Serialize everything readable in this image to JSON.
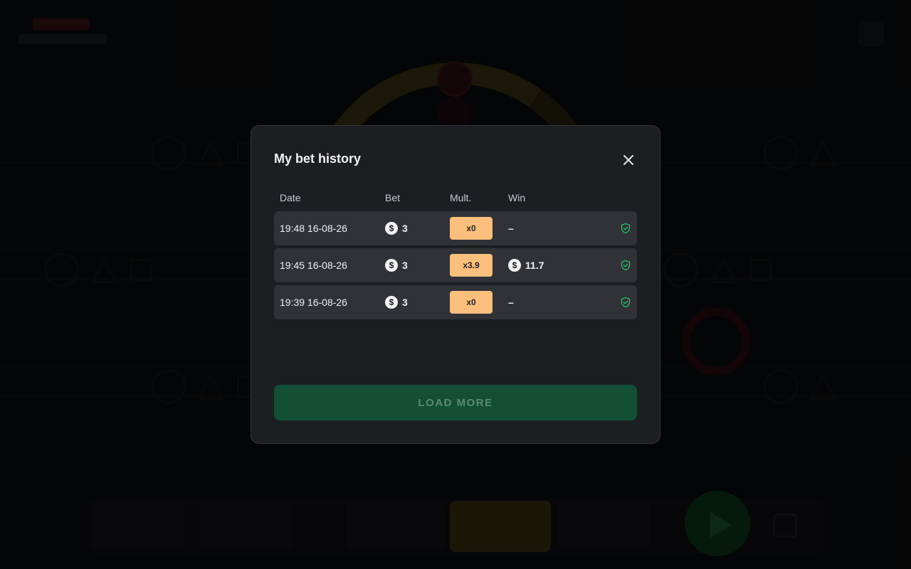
{
  "modal": {
    "title": "My bet history",
    "columns": {
      "date": "Date",
      "bet": "Bet",
      "mult": "Mult.",
      "win": "Win"
    },
    "rows": [
      {
        "date": "19:48 16-08-26",
        "bet": "3",
        "mult": "x0",
        "win": "–",
        "win_has_coin": false,
        "verified": true
      },
      {
        "date": "19:45 16-08-26",
        "bet": "3",
        "mult": "x3.9",
        "win": "11.7",
        "win_has_coin": true,
        "verified": true
      },
      {
        "date": "19:39 16-08-26",
        "bet": "3",
        "mult": "x0",
        "win": "–",
        "win_has_coin": false,
        "verified": true
      }
    ],
    "load_more_label": "LOAD MORE",
    "currency_symbol": "$"
  },
  "icons": {
    "close": "close-icon",
    "coin": "dollar-coin-icon",
    "verified": "shield-check-icon"
  },
  "colors": {
    "modal_bg": "#1d1e22",
    "row_bg": "#303237",
    "mult_badge": "#fbbf7d",
    "load_more_bg": "#124f35",
    "load_more_text": "#5d8a72",
    "verified_green": "#22c55e"
  }
}
